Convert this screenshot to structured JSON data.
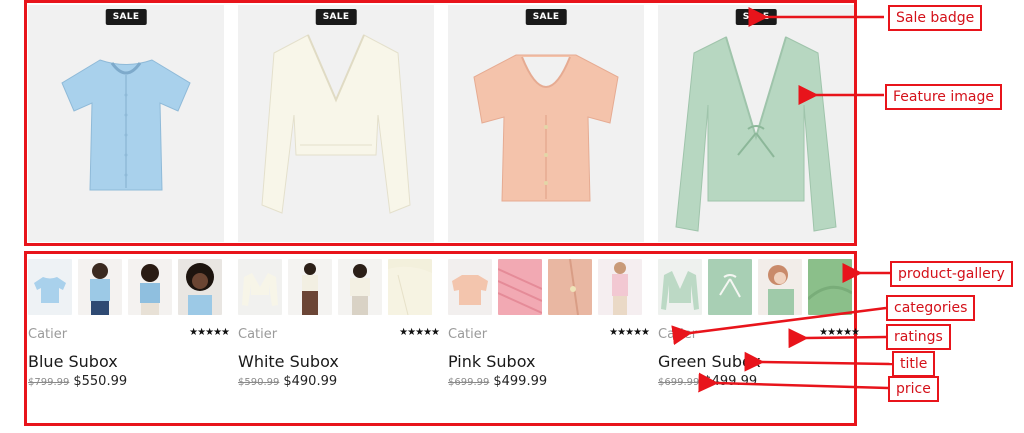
{
  "products": [
    {
      "badge": "SALE",
      "category": "Catier",
      "rating_stars": "★★★★★",
      "rating": 5,
      "title": "Blue Subox",
      "old_price": "$799.99",
      "price": "$550.99",
      "colors": {
        "main": "#a9d1ec",
        "bg": "#f1f1f1"
      },
      "gallery": [
        "#a9d1ec",
        "#5d3f2e",
        "#8fbfdf",
        "#3b2a20"
      ]
    },
    {
      "badge": "SALE",
      "category": "Catier",
      "rating_stars": "★★★★★",
      "rating": 5,
      "title": "White Subox",
      "old_price": "$590.99",
      "price": "$490.99",
      "colors": {
        "main": "#f7f5e6",
        "bg": "#f1f1f1"
      },
      "gallery": [
        "#f5f3e6",
        "#6b4536",
        "#e8e2d2",
        "#f3f0dc"
      ]
    },
    {
      "badge": "SALE",
      "category": "Catier",
      "rating_stars": "★★★★★",
      "rating": 5,
      "title": "Pink Subox",
      "old_price": "$699.99",
      "price": "$499.99",
      "colors": {
        "main": "#f3c0a8",
        "bg": "#f1f1f1"
      },
      "gallery": [
        "#f3c5ad",
        "#f2a9b3",
        "#e9b7a2",
        "#f2c8d2"
      ]
    },
    {
      "badge": "SALE",
      "category": "Catier",
      "rating_stars": "★★★★★",
      "rating": 5,
      "title": "Green Subox",
      "old_price": "$699.99",
      "price": "$499.99",
      "colors": {
        "main": "#b4d5bf",
        "bg": "#f1f1f1"
      },
      "gallery": [
        "#bcd9c5",
        "#a8cfb4",
        "#c98a6a",
        "#8bbf8a"
      ]
    }
  ],
  "annotations": {
    "sale_badge": "Sale badge",
    "feature_image": "Feature image",
    "product_gallery": "product-gallery",
    "categories": "categories",
    "ratings": "ratings",
    "title": "title",
    "price": "price"
  },
  "accent": "#e8141b"
}
